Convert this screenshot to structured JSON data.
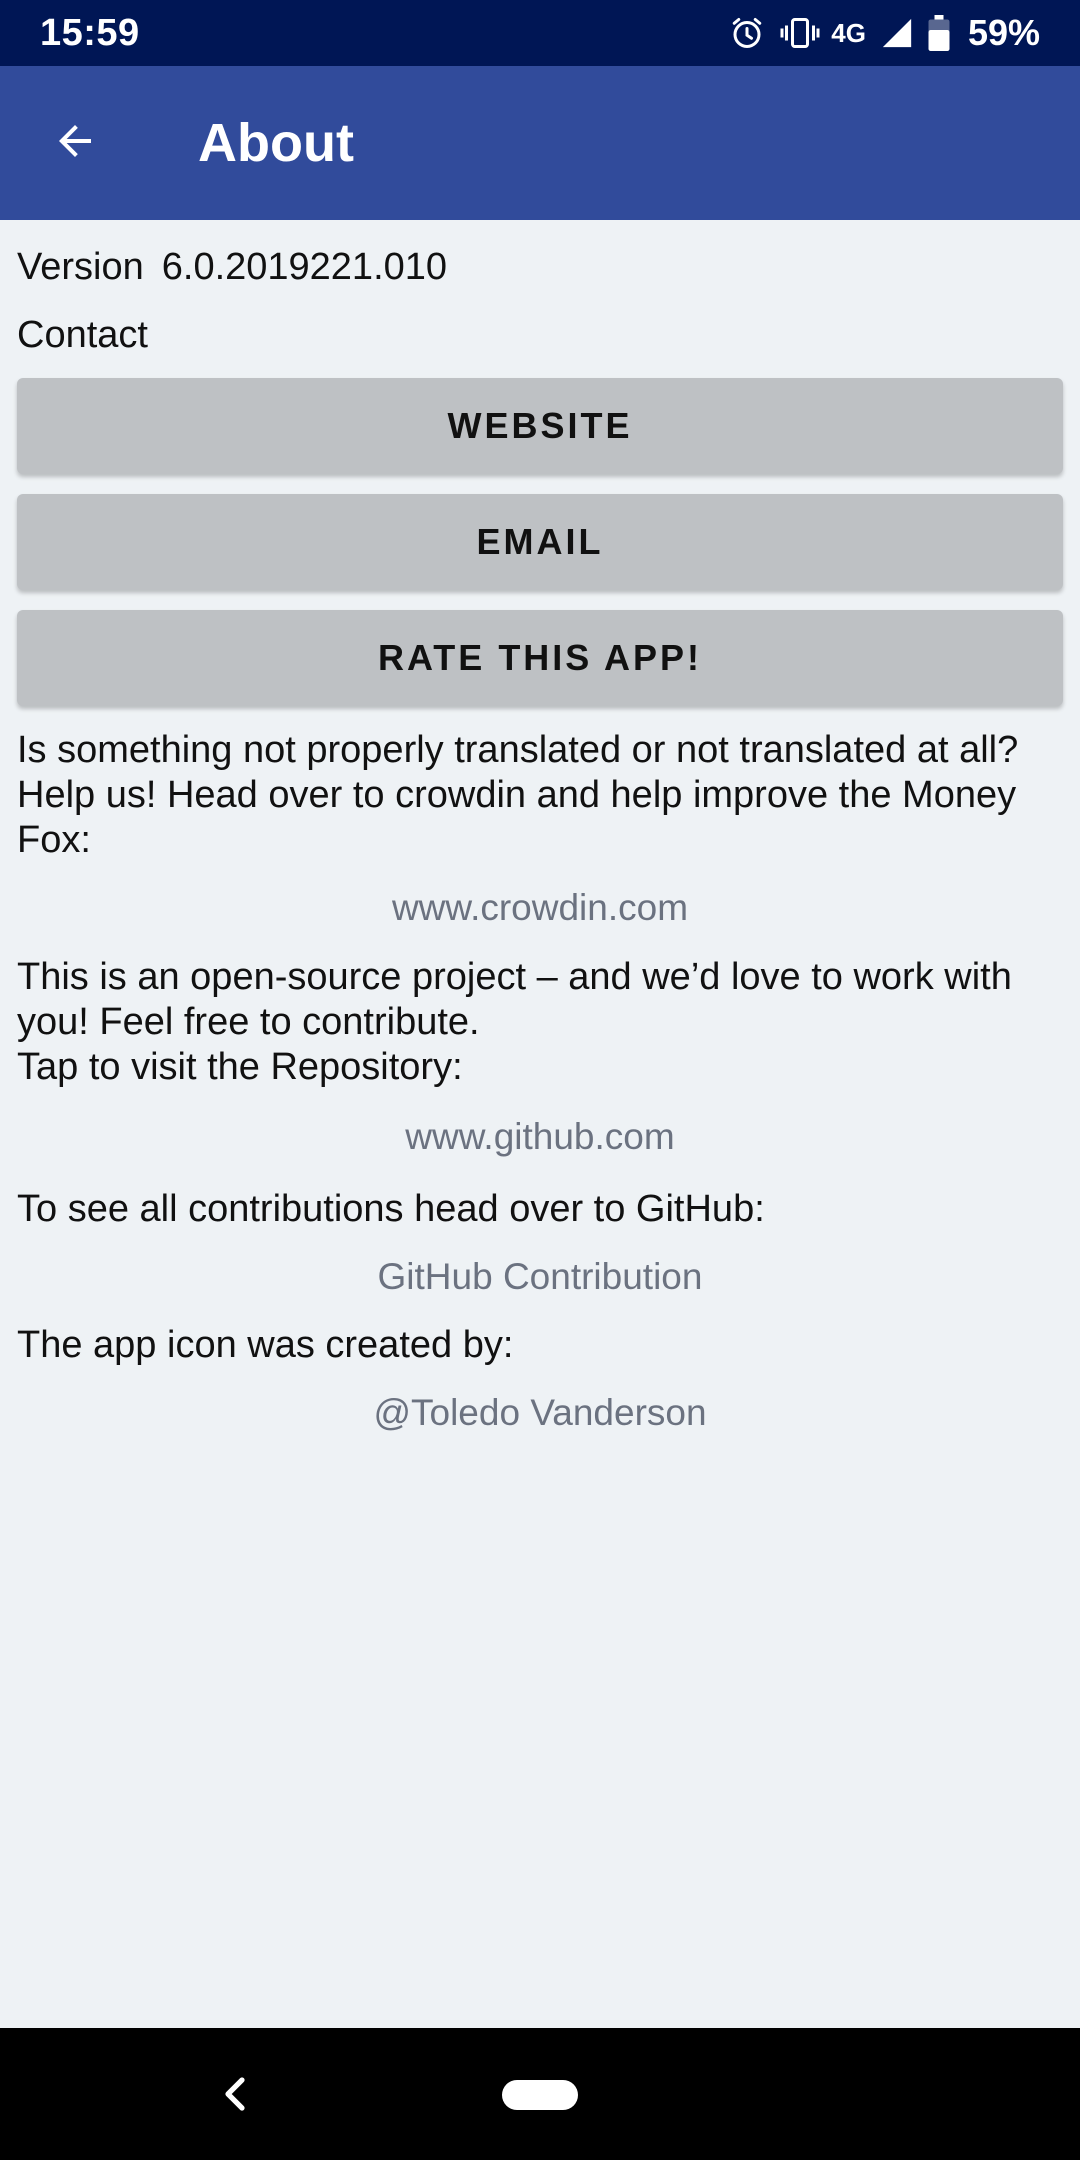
{
  "status_bar": {
    "time": "15:59",
    "network": "4G",
    "battery": "59%",
    "icons": [
      "alarm-icon",
      "vibrate-icon",
      "signal-icon",
      "battery-icon"
    ]
  },
  "app_bar": {
    "title": "About",
    "back_icon": "arrow-back-icon",
    "color": "#314b9b"
  },
  "version": {
    "label": "Version",
    "value": "6.0.2019221.010"
  },
  "contact": {
    "label": "Contact",
    "buttons": {
      "website": "WEBSITE",
      "email": "EMAIL",
      "rate": "RATE THIS APP!"
    }
  },
  "translation": {
    "lines": [
      "Is something not properly translated or not translated at all?",
      "Help us! Head over to crowdin and help improve the Money",
      "Fox:"
    ],
    "link": "www.crowdin.com"
  },
  "open_source": {
    "lines": [
      "This is an open-source project – and we’d love to work with",
      "you! Feel free to contribute.",
      "Tap to visit the Repository:"
    ],
    "link": "www.github.com"
  },
  "contributions": {
    "text": "To see all contributions head over to GitHub:",
    "link": "GitHub Contribution"
  },
  "app_icon": {
    "text": "The app icon was created by:",
    "link": "@Toledo Vanderson"
  },
  "colors": {
    "status_bar": "#001655",
    "background": "#eef2f5",
    "button": "#bec1c4",
    "link_text": "#6b7280"
  }
}
